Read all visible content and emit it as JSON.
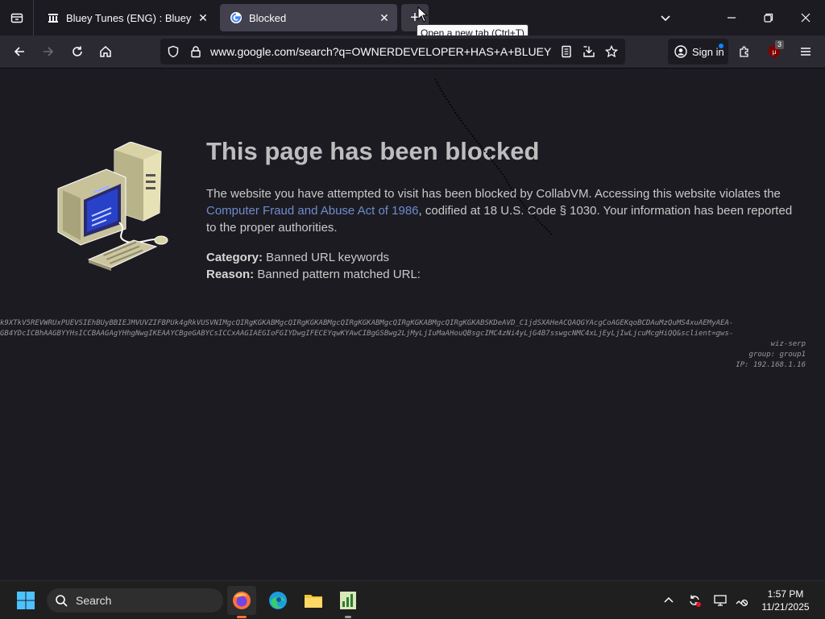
{
  "tabs": [
    {
      "title": "Bluey Tunes (ENG) : Bluey and A"
    },
    {
      "title": "Blocked"
    }
  ],
  "tooltip": "Open a new tab (Ctrl+T)",
  "navbar": {
    "url": "www.google.com/search?q=OWNERDEVELOPER+HAS+A+BLUEY+PO",
    "signin_label": "Sign in",
    "extension_badge": "3"
  },
  "page": {
    "heading": "This page has been blocked",
    "desc_part1": "The website you have attempted to visit has been blocked by CollabVM. Accessing this website violates the ",
    "desc_link": "Computer Fraud and Abuse Act of 1986",
    "desc_part2": ", codified at 18 U.S. Code § 1030. Your information has been reported to the proper authorities.",
    "category_label": "Category:",
    "category_value": " Banned URL keywords",
    "reason_label": "Reason:",
    "reason_value": " Banned pattern matched URL:",
    "blocked_url_line1": "k9XTkV5REVWRUxPUEVSIEhBUyBBIEJMVUVZIFBPUk4gRkVUSVNIMgcQIRgKGKABMgcQIRgKGKABMgcQIRgKGKABMgcQIRgKGKABMgcQIRgKGKABSKDeAVD_C1jdSXAHeACQAQGYAcgCoAGEKqoBCDAuMzQuMS4xuAEMyAEA-",
    "blocked_url_line2": "GB4YDcICBhAAGBYYHsICCBAAGAgYHhgNwgIKEAAYCBgeGABYCsICCxAAGIAEGIoFGIYDwgIFECEYqwKYAwCIBgGSBwg2LjMyLjIuMaAHouQBsgcIMC4zNi4yLjG4B7sswgcNMC4xLjEyLjIwLjcuMcgHiQQ&sclient=gws-",
    "blocked_url_line3": "wiz-serp",
    "group": "group: group1",
    "ip": "IP: 192.168.1.16"
  },
  "taskbar": {
    "search_label": "Search",
    "time": "1:57 PM",
    "date": "11/21/2025"
  },
  "colors": {
    "link": "#6e8ccc",
    "accent_blue": "#0a84ff"
  }
}
